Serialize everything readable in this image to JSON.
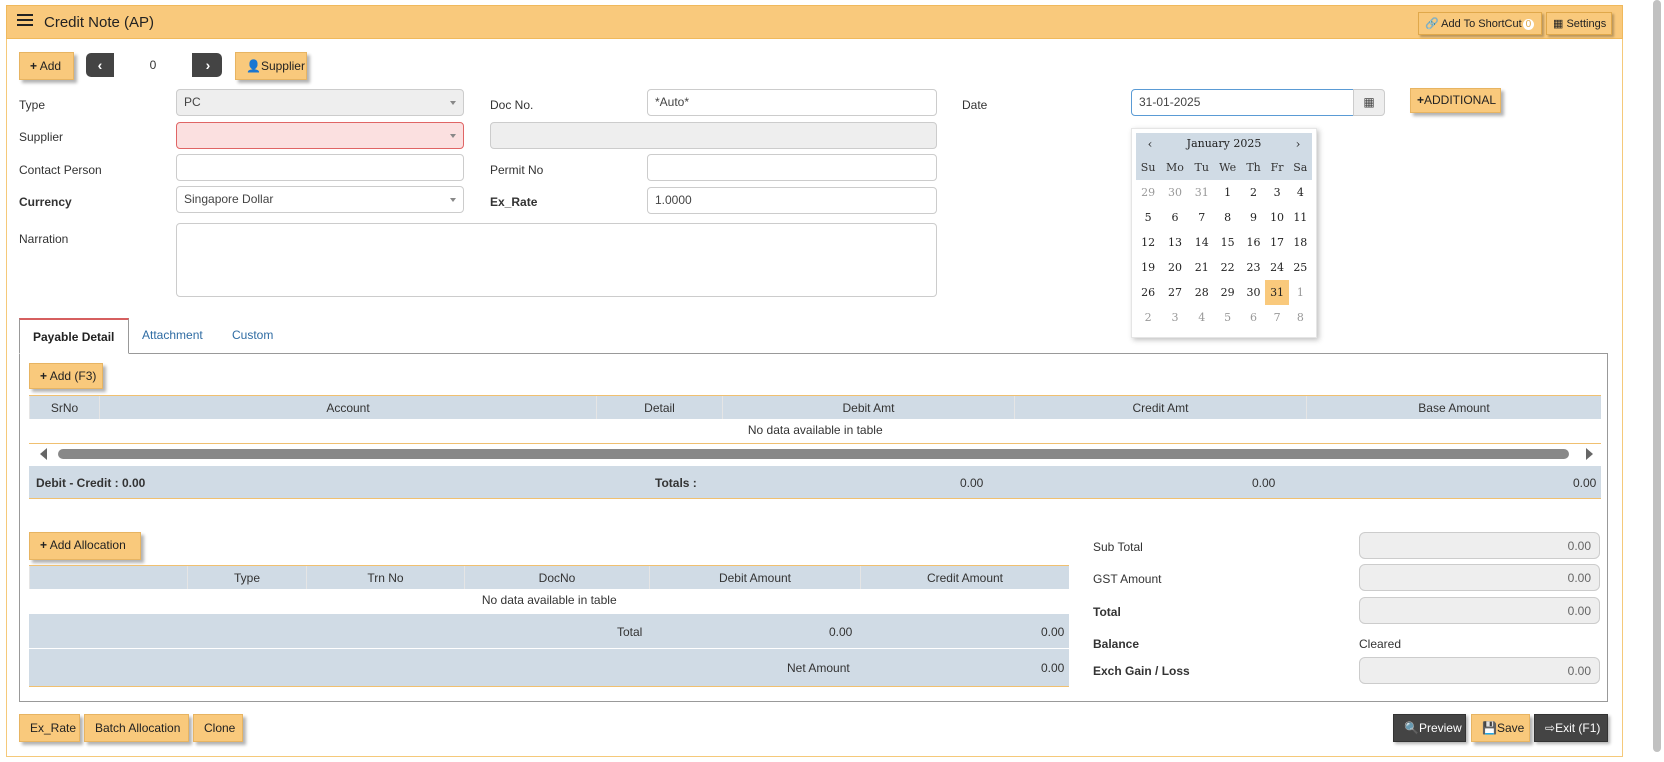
{
  "header": {
    "title": "Credit Note (AP)",
    "shortcut_label": "Add To ShortCut",
    "shortcut_count": "0",
    "settings_label": "Settings"
  },
  "toolbar": {
    "add_label": "Add",
    "record_no": "0",
    "supplier_label": "Supplier"
  },
  "form": {
    "type_label": "Type",
    "type_value": "PC",
    "docno_label": "Doc No.",
    "docno_value": "*Auto*",
    "date_label": "Date",
    "date_value": "31-01-2025",
    "additional_label": "ADDITIONAL",
    "supplier_label": "Supplier",
    "supplier_value": "",
    "supplier_name": "",
    "contact_label": "Contact Person",
    "contact_value": "",
    "permit_label": "Permit No",
    "permit_value": "",
    "currency_label": "Currency",
    "currency_value": "Singapore Dollar",
    "exrate_label": "Ex_Rate",
    "exrate_value": "1.0000",
    "narration_label": "Narration",
    "narration_value": ""
  },
  "calendar": {
    "month_label": "January 2025",
    "prev": "‹",
    "next": "›",
    "weekdays": [
      "Su",
      "Mo",
      "Tu",
      "We",
      "Th",
      "Fr",
      "Sa"
    ],
    "weeks": [
      [
        "29",
        "30",
        "31",
        "1",
        "2",
        "3",
        "4"
      ],
      [
        "5",
        "6",
        "7",
        "8",
        "9",
        "10",
        "11"
      ],
      [
        "12",
        "13",
        "14",
        "15",
        "16",
        "17",
        "18"
      ],
      [
        "19",
        "20",
        "21",
        "22",
        "23",
        "24",
        "25"
      ],
      [
        "26",
        "27",
        "28",
        "29",
        "30",
        "31",
        "1"
      ],
      [
        "2",
        "3",
        "4",
        "5",
        "6",
        "7",
        "8"
      ]
    ],
    "selected": "31"
  },
  "tabs": [
    "Payable Detail",
    "Attachment",
    "Custom"
  ],
  "payable": {
    "add_label": "Add (F3)",
    "columns": [
      "SrNo",
      "Account",
      "Detail",
      "Debit Amt",
      "Credit Amt",
      "Base Amount"
    ],
    "empty_text": "No data available in table",
    "footer_left": "Debit - Credit : 0.00",
    "footer_totals_label": "Totals :",
    "footer_debit": "0.00",
    "footer_credit": "0.00",
    "footer_base": "0.00"
  },
  "allocation": {
    "add_label": "Add Allocation",
    "columns": [
      "",
      "Type",
      "Trn No",
      "DocNo",
      "Debit Amount",
      "Credit Amount"
    ],
    "empty_text": "No data available in table",
    "total_label": "Total",
    "total_debit": "0.00",
    "total_credit": "0.00",
    "net_label": "Net Amount",
    "net_value": "0.00"
  },
  "summary": {
    "subtotal_label": "Sub Total",
    "subtotal_value": "0.00",
    "gst_label": "GST Amount",
    "gst_value": "0.00",
    "total_label": "Total",
    "total_value": "0.00",
    "balance_label": "Balance",
    "balance_value": "Cleared",
    "exch_label": "Exch Gain / Loss",
    "exch_value": "0.00"
  },
  "footer": {
    "exrate_label": "Ex_Rate",
    "batch_label": "Batch Allocation",
    "clone_label": "Clone",
    "preview_label": "Preview",
    "save_label": "Save",
    "exit_label": "Exit (F1)"
  },
  "colors": {
    "accent": "#f9c97c",
    "grid_header": "#d0dbe5",
    "dark_button": "#444444"
  }
}
